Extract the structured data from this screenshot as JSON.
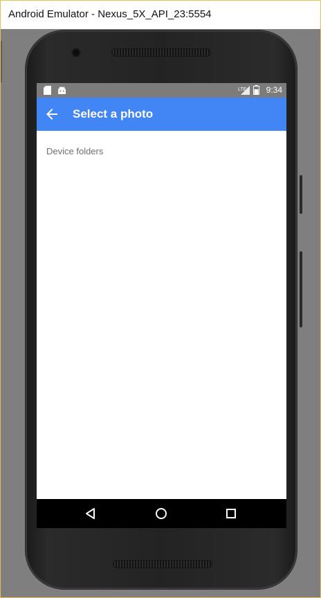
{
  "window": {
    "title": "Android Emulator - Nexus_5X_API_23:5554"
  },
  "status_bar": {
    "time": "9:34",
    "left_icons": [
      "sd-card-icon",
      "android-icon"
    ],
    "right_icons": [
      "lte-signal-icon",
      "battery-icon"
    ]
  },
  "app_bar": {
    "title": "Select a photo",
    "back_icon": "arrow-back-icon",
    "color": "#4285f4"
  },
  "content": {
    "section_label": "Device folders"
  },
  "nav_bar": {
    "buttons": [
      "back-triangle-icon",
      "home-circle-icon",
      "recents-square-icon"
    ]
  }
}
